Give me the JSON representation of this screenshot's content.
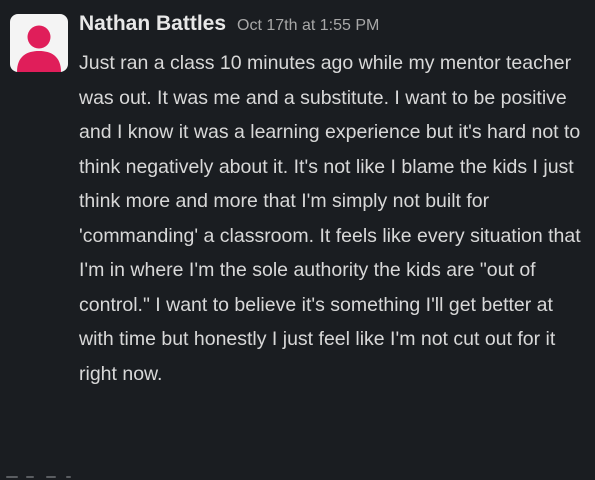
{
  "message": {
    "author": "Nathan Battles",
    "timestamp": "Oct 17th at 1:55 PM",
    "avatar_icon": "user-silhouette-icon",
    "avatar_bg": "#f4f4f4",
    "avatar_fg": "#e01e5a",
    "text": "Just ran a class 10 minutes ago while my mentor teacher was out. It was me and a substitute. I want to be positive and I know it was a learning experience but it's hard not to think negatively about it. It's not like I blame the kids I just think more and more that I'm simply not built for 'commanding' a classroom. It feels like every situation that I'm in where I'm the sole authority the kids are \"out of control.\" I want to believe it's something I'll get better at with time but honestly I just feel like I'm not cut out for it right now."
  },
  "colors": {
    "background": "#1a1d21",
    "author": "#e8e8e8",
    "timestamp": "#a8a8a8",
    "body_text": "#d8d8d8"
  }
}
